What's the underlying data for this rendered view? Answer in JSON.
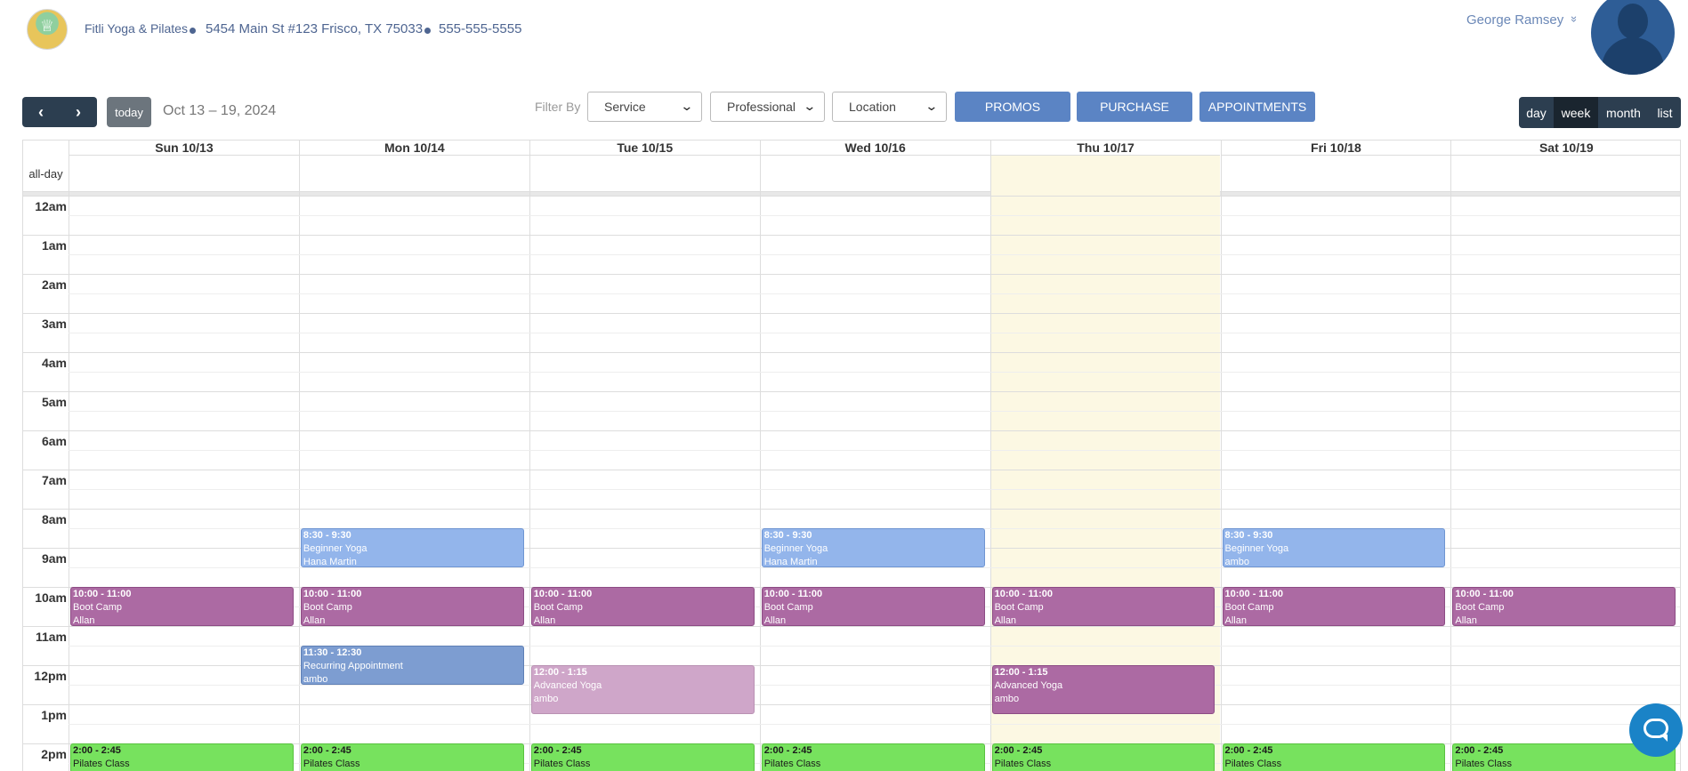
{
  "header": {
    "business_name": "Fitli Yoga & Pilates",
    "address": "5454 Main St #123 Frisco, TX 75033",
    "phone": "555-555-5555",
    "user_name": "George Ramsey",
    "user_chevron": "»"
  },
  "toolbar": {
    "prev": "‹",
    "next": "›",
    "today_label": "today",
    "date_range": "Oct 13 – 19, 2024",
    "filter_label": "Filter By",
    "filters": [
      "Service",
      "Professional",
      "Location"
    ],
    "actions": [
      "PROMOS",
      "PURCHASE",
      "APPOINTMENTS"
    ],
    "views": [
      "day",
      "week",
      "month",
      "list"
    ],
    "active_view": "week"
  },
  "calendar": {
    "days": [
      "Sun 10/13",
      "Mon 10/14",
      "Tue 10/15",
      "Wed 10/16",
      "Thu 10/17",
      "Fri 10/18",
      "Sat 10/19"
    ],
    "today_day": "Thu 10/17",
    "allday_label": "all-day",
    "hours": [
      "12am",
      "1am",
      "2am",
      "3am",
      "4am",
      "5am",
      "6am",
      "7am",
      "8am",
      "9am",
      "10am",
      "11am",
      "12pm",
      "1pm",
      "2pm"
    ],
    "events": [
      {
        "day": 1,
        "time": "8:30 - 9:30",
        "name": "Beginner Yoga",
        "person": "Hana Martin",
        "type": "beginner",
        "start": 8.5,
        "end": 9.5
      },
      {
        "day": 3,
        "time": "8:30 - 9:30",
        "name": "Beginner Yoga",
        "person": "Hana Martin",
        "type": "beginner",
        "start": 8.5,
        "end": 9.5
      },
      {
        "day": 5,
        "time": "8:30 - 9:30",
        "name": "Beginner Yoga",
        "person": "ambo",
        "type": "beginner",
        "start": 8.5,
        "end": 9.5
      },
      {
        "day": 0,
        "time": "10:00 - 11:00",
        "name": "Boot Camp",
        "person": "Allan",
        "type": "bootcamp",
        "start": 10,
        "end": 11
      },
      {
        "day": 1,
        "time": "10:00 - 11:00",
        "name": "Boot Camp",
        "person": "Allan",
        "type": "bootcamp",
        "start": 10,
        "end": 11
      },
      {
        "day": 2,
        "time": "10:00 - 11:00",
        "name": "Boot Camp",
        "person": "Allan",
        "type": "bootcamp",
        "start": 10,
        "end": 11
      },
      {
        "day": 3,
        "time": "10:00 - 11:00",
        "name": "Boot Camp",
        "person": "Allan",
        "type": "bootcamp",
        "start": 10,
        "end": 11
      },
      {
        "day": 4,
        "time": "10:00 - 11:00",
        "name": "Boot Camp",
        "person": "Allan",
        "type": "bootcamp",
        "start": 10,
        "end": 11
      },
      {
        "day": 5,
        "time": "10:00 - 11:00",
        "name": "Boot Camp",
        "person": "Allan",
        "type": "bootcamp",
        "start": 10,
        "end": 11
      },
      {
        "day": 6,
        "time": "10:00 - 11:00",
        "name": "Boot Camp",
        "person": "Allan",
        "type": "bootcamp",
        "start": 10,
        "end": 11
      },
      {
        "day": 1,
        "time": "11:30 - 12:30",
        "name": "Recurring Appointment",
        "person": "ambo",
        "type": "recurring",
        "start": 11.5,
        "end": 12.5
      },
      {
        "day": 2,
        "time": "12:00 - 1:15",
        "name": "Advanced Yoga",
        "person": "ambo",
        "type": "advanced-past",
        "start": 12,
        "end": 13.25
      },
      {
        "day": 4,
        "time": "12:00 - 1:15",
        "name": "Advanced Yoga",
        "person": "ambo",
        "type": "advanced",
        "start": 12,
        "end": 13.25
      },
      {
        "day": 0,
        "time": "2:00 - 2:45",
        "name": "Pilates Class",
        "person": "",
        "type": "pilates",
        "start": 14,
        "end": 14.75
      },
      {
        "day": 1,
        "time": "2:00 - 2:45",
        "name": "Pilates Class",
        "person": "",
        "type": "pilates",
        "start": 14,
        "end": 14.75
      },
      {
        "day": 2,
        "time": "2:00 - 2:45",
        "name": "Pilates Class",
        "person": "",
        "type": "pilates",
        "start": 14,
        "end": 14.75
      },
      {
        "day": 3,
        "time": "2:00 - 2:45",
        "name": "Pilates Class",
        "person": "",
        "type": "pilates",
        "start": 14,
        "end": 14.75
      },
      {
        "day": 4,
        "time": "2:00 - 2:45",
        "name": "Pilates Class",
        "person": "",
        "type": "pilates",
        "start": 14,
        "end": 14.75
      },
      {
        "day": 5,
        "time": "2:00 - 2:45",
        "name": "Pilates Class",
        "person": "",
        "type": "pilates",
        "start": 14,
        "end": 14.75
      },
      {
        "day": 6,
        "time": "2:00 - 2:45",
        "name": "Pilates Class",
        "person": "",
        "type": "pilates",
        "start": 14,
        "end": 14.75
      }
    ]
  },
  "colors": {
    "beginner": "#93b5eb",
    "bootcamp": "#ac6aa3",
    "recurring": "#7d9dd1",
    "pilates": "#77e25e",
    "today_bg": "#fcf8e3",
    "nav_dark": "#2c3e50",
    "action_blue": "#5b84c4"
  },
  "icons": {
    "avatar": "user-silhouette-icon",
    "chat": "chat-bubble-icon",
    "logo": "business-logo"
  }
}
